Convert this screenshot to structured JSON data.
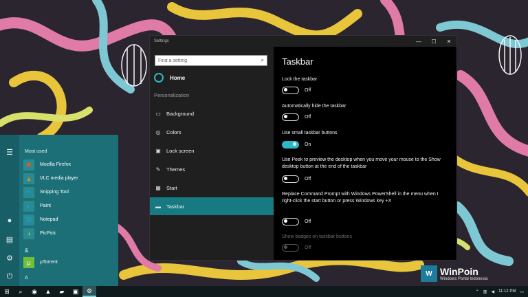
{
  "colors": {
    "accent": "#2bb9c9",
    "selected": "#177a82",
    "start_bg": "#1d6f77"
  },
  "window": {
    "title": "Settings",
    "controls": {
      "minimize": "—",
      "maximize": "☐",
      "close": "✕"
    }
  },
  "nav": {
    "search_placeholder": "Find a setting",
    "search_icon": "search-icon",
    "home_label": "Home",
    "section_label": "Personalization",
    "items": [
      {
        "label": "Background",
        "icon": "image-icon",
        "glyph": "▭"
      },
      {
        "label": "Colors",
        "icon": "palette-icon",
        "glyph": "◎"
      },
      {
        "label": "Lock screen",
        "icon": "lock-screen-icon",
        "glyph": "▣"
      },
      {
        "label": "Themes",
        "icon": "brush-icon",
        "glyph": "✎"
      },
      {
        "label": "Start",
        "icon": "start-icon",
        "glyph": "▦"
      },
      {
        "label": "Taskbar",
        "icon": "taskbar-icon",
        "glyph": "▬",
        "selected": true
      }
    ]
  },
  "content": {
    "title": "Taskbar",
    "settings": [
      {
        "label": "Lock the taskbar",
        "state": "Off",
        "on": false,
        "disabled": false
      },
      {
        "label": "Automatically hide the taskbar",
        "state": "Off",
        "on": false,
        "disabled": false
      },
      {
        "label": "Use small taskbar buttons",
        "state": "On",
        "on": true,
        "disabled": false
      },
      {
        "label": "Use Peek to preview the desktop when you move your mouse to the Show desktop button at the end of the taskbar",
        "state": "Off",
        "on": false,
        "disabled": false
      },
      {
        "label": "Replace Command Prompt with Windows PowerShell in the menu when I right-click the start button or press Windows key +X",
        "state": "Off",
        "on": false,
        "disabled": false
      },
      {
        "label": "Show badges on taskbar buttons",
        "state": "Off",
        "on": false,
        "disabled": true
      }
    ]
  },
  "start_menu": {
    "most_used_label": "Most used",
    "apps": [
      {
        "label": "Mozilla Firefox",
        "icon": "firefox-icon",
        "glyph": "◉",
        "color": "#e66000"
      },
      {
        "label": "VLC media player",
        "icon": "vlc-icon",
        "glyph": "▲",
        "color": "#f08a00"
      },
      {
        "label": "Snipping Tool",
        "icon": "scissors-icon",
        "glyph": "✂",
        "color": "#1a9fd6"
      },
      {
        "label": "Paint",
        "icon": "palette-icon",
        "glyph": "◐",
        "color": "#1a9fd6"
      },
      {
        "label": "Notepad",
        "icon": "notepad-icon",
        "glyph": "▤",
        "color": "#1a9fd6"
      },
      {
        "label": "PicPick",
        "icon": "picpick-icon",
        "glyph": "◑",
        "color": "#f0c000"
      }
    ],
    "group_amp": "&",
    "group_apps": [
      {
        "label": "µTorrent",
        "icon": "utorrent-icon",
        "glyph": "µ",
        "color": "#6fbf3a"
      }
    ],
    "group_a": "A"
  },
  "taskbar": {
    "items": [
      {
        "icon": "windows-icon",
        "glyph": "⊞"
      },
      {
        "icon": "search-icon",
        "glyph": "⌕"
      },
      {
        "icon": "firefox-icon",
        "glyph": "◉"
      },
      {
        "icon": "vlc-icon",
        "glyph": "▲"
      },
      {
        "icon": "file-explorer-icon",
        "glyph": "▰"
      },
      {
        "icon": "store-icon",
        "glyph": "▣"
      },
      {
        "icon": "settings-gear-icon",
        "glyph": "⚙",
        "active": true
      }
    ],
    "clock": "11:12 PM"
  },
  "watermark": {
    "logo": "W",
    "main": "WinPoin",
    "sub": "Windows Portal Indonesia"
  }
}
